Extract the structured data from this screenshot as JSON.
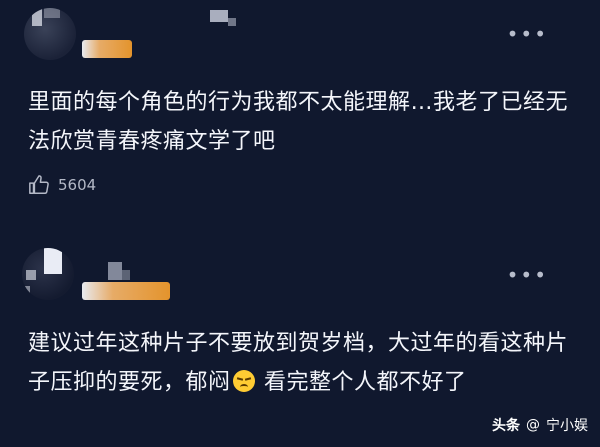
{
  "comments": [
    {
      "text": "里面的每个角色的行为我都不太能理解…我老了已经无法欣赏青春疼痛文学了吧",
      "like_count": "5604",
      "more_icon": "more-dots-icon"
    },
    {
      "text_before_emoji": "建议过年这种片子不要放到贺岁档，大过年的看这种片子压抑的要死，郁闷",
      "emoji": "disappointed-face-emoji",
      "text_after_emoji": " 看完整个人都不好了",
      "more_icon": "more-dots-icon"
    }
  ],
  "watermark": {
    "brand": "头条",
    "handle": "宁小娱"
  }
}
